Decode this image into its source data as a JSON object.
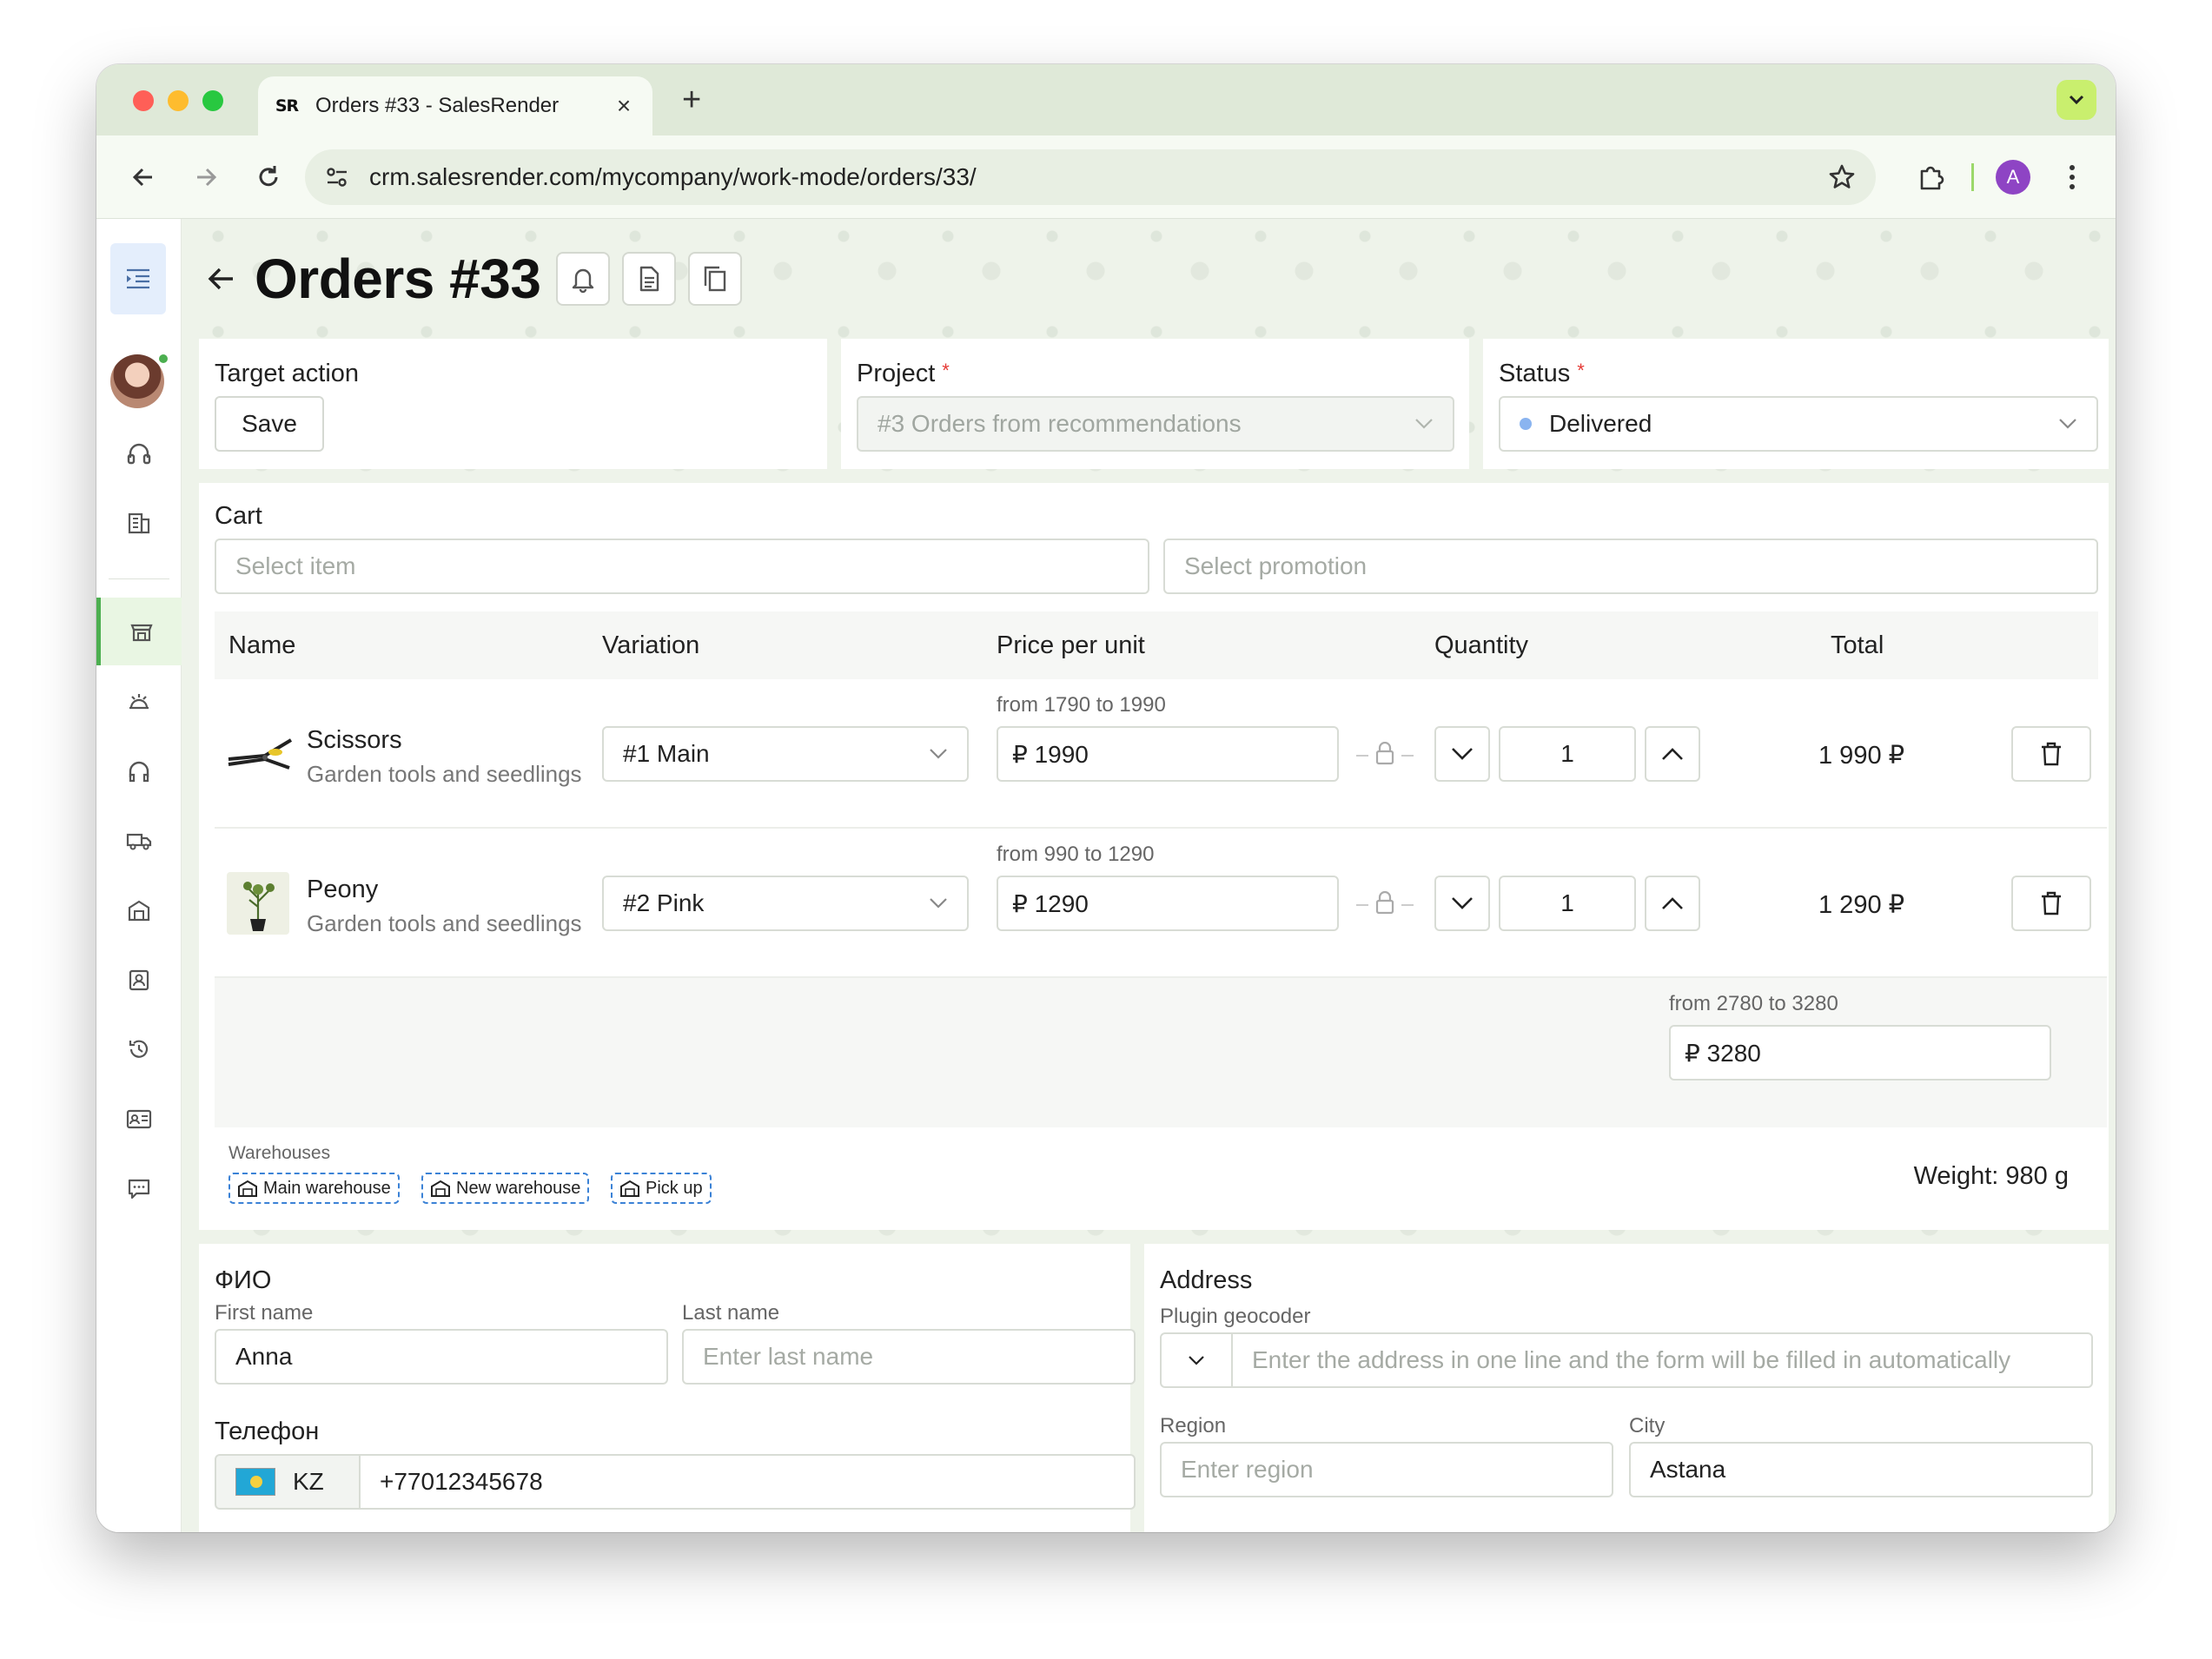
{
  "browser": {
    "tab_title": "Orders #33 - SalesRender",
    "tab_logo": "SR",
    "url": "crm.salesrender.com/mycompany/work-mode/orders/33/",
    "profile_initial": "A"
  },
  "header": {
    "title": "Orders #33"
  },
  "target_action": {
    "label": "Target action",
    "save_label": "Save"
  },
  "project": {
    "label": "Project",
    "required": "*",
    "value": "#3 Orders from recommendations"
  },
  "status": {
    "label": "Status",
    "required": "*",
    "value": "Delivered",
    "dot_color": "#8ab4f0"
  },
  "cart": {
    "label": "Cart",
    "item_placeholder": "Select item",
    "promotion_placeholder": "Select promotion",
    "columns": {
      "name": "Name",
      "variation": "Variation",
      "price": "Price per unit",
      "quantity": "Quantity",
      "total": "Total"
    },
    "rows": [
      {
        "name": "Scissors",
        "category": "Garden tools and seedlings",
        "variation": "#1 Main",
        "range": "from 1790 to 1990",
        "price": "₽ 1990",
        "quantity": "1",
        "total": "1 990 ₽"
      },
      {
        "name": "Peony",
        "category": "Garden tools and seedlings",
        "variation": "#2 Pink",
        "range": "from 990 to 1290",
        "price": "₽ 1290",
        "quantity": "1",
        "total": "1 290 ₽"
      }
    ],
    "summary_range": "from 2780 to 3280",
    "summary_price": "₽ 3280",
    "warehouses_label": "Warehouses",
    "warehouses": [
      "Main warehouse",
      "New warehouse",
      "Pick up"
    ],
    "weight": "Weight: 980 g"
  },
  "contact": {
    "fio_label": "ФИО",
    "first_name_label": "First name",
    "first_name_value": "Anna",
    "last_name_label": "Last name",
    "last_name_placeholder": "Enter last name",
    "phone_label": "Телефон",
    "phone_country": "KZ",
    "phone_value": "+77012345678"
  },
  "address": {
    "label": "Address",
    "geocoder_label": "Plugin geocoder",
    "geocoder_placeholder": "Enter the address in one line and the form will be filled in automatically",
    "region_label": "Region",
    "region_placeholder": "Enter region",
    "city_label": "City",
    "city_value": "Astana"
  },
  "colors": {
    "accent_green": "#4caf50",
    "required_red": "#e53935",
    "warehouse_border": "#3b82d6"
  }
}
